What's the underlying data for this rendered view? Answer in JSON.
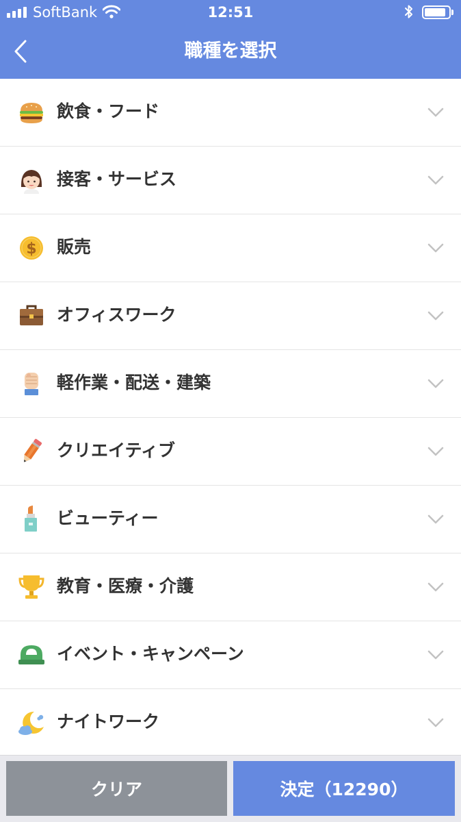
{
  "status_bar": {
    "carrier": "SoftBank",
    "time": "12:51"
  },
  "nav": {
    "title": "職種を選択",
    "back_icon": "chevron-left-icon"
  },
  "categories": [
    {
      "label": "飲食・フード",
      "icon": "hamburger-icon"
    },
    {
      "label": "接客・サービス",
      "icon": "woman-face-icon"
    },
    {
      "label": "販売",
      "icon": "dollar-coin-icon"
    },
    {
      "label": "オフィスワーク",
      "icon": "briefcase-icon"
    },
    {
      "label": "軽作業・配送・建築",
      "icon": "fist-icon"
    },
    {
      "label": "クリエイティブ",
      "icon": "pencil-icon"
    },
    {
      "label": "ビューティー",
      "icon": "lipstick-icon"
    },
    {
      "label": "教育・医療・介護",
      "icon": "trophy-icon"
    },
    {
      "label": "イベント・キャンペーン",
      "icon": "cap-icon"
    },
    {
      "label": "ナイトワーク",
      "icon": "moon-icon"
    }
  ],
  "footer": {
    "clear_label": "クリア",
    "submit_label": "決定（12290）"
  },
  "colors": {
    "accent": "#6589e0",
    "clear_button": "#8d9299",
    "text": "#333333",
    "chevron": "#c2c2c2"
  }
}
